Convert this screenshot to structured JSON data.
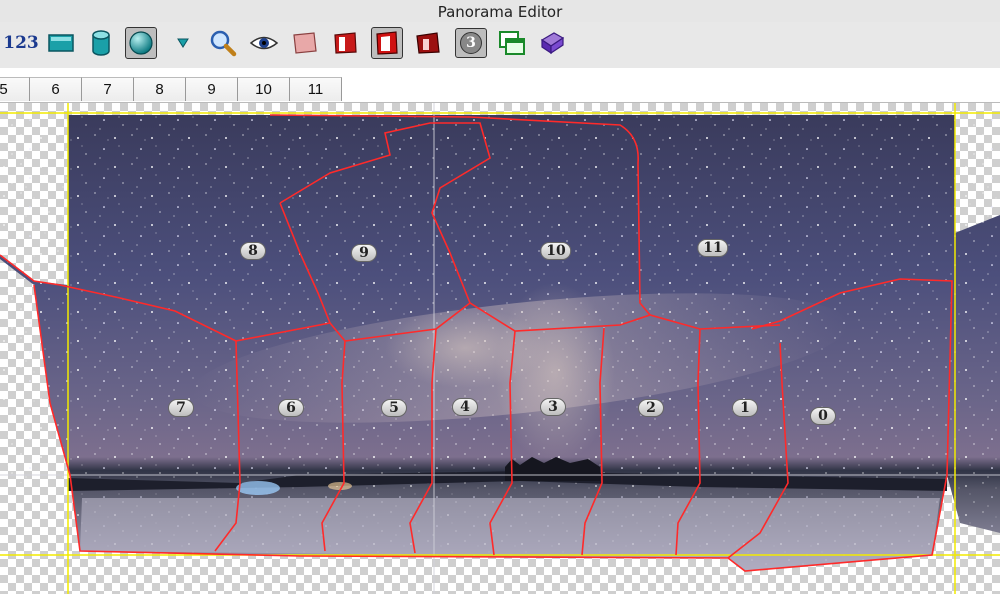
{
  "window": {
    "title": "Panorama Editor"
  },
  "toolbar": {
    "numbers_label": "123",
    "layer_badge": "3"
  },
  "tabs": [
    "5",
    "6",
    "7",
    "8",
    "9",
    "10",
    "11"
  ],
  "images": [
    {
      "label": "0"
    },
    {
      "label": "1"
    },
    {
      "label": "2"
    },
    {
      "label": "3"
    },
    {
      "label": "4"
    },
    {
      "label": "5"
    },
    {
      "label": "6"
    },
    {
      "label": "7"
    },
    {
      "label": "8"
    },
    {
      "label": "9"
    },
    {
      "label": "10"
    },
    {
      "label": "11"
    }
  ],
  "colors": {
    "seam": "#ff2a2a",
    "guide": "#f2ea00",
    "sky": "#4a4e78",
    "ground": "#9a97ae"
  }
}
